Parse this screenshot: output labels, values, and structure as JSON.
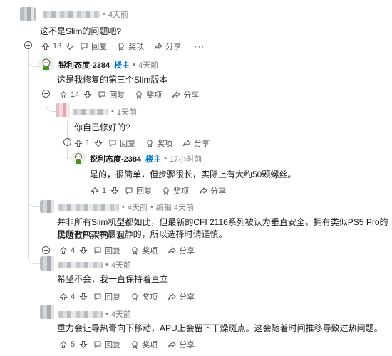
{
  "comments": [
    {
      "time": "4天前",
      "text": "这不是Slim的问题吧?",
      "votes": "13"
    },
    {
      "user": "锐利态度-2384",
      "op_badge": "楼主",
      "time": "4天前",
      "text": "这是我修复的第三个Slim版本",
      "votes": "14"
    },
    {
      "time": "1天前",
      "text": "你自己修好的?",
      "votes": "1"
    },
    {
      "user": "锐利态度-2384",
      "op_badge": "楼主",
      "time": "17小时前",
      "text": "是的，很简单，但步骤很长，实际上有大约50颗螺丝。",
      "votes": "1"
    },
    {
      "time": "4天前",
      "edited": "编辑 4天前",
      "text_line1": "并非所有Slim机型都如此，但最新的CFI 2116系列被认为垂直安全，拥有类似PS5 Pro的优越散热架构，且",
      "text_line2": "是所有PS5中最安静的，所以选择时请谨慎。",
      "votes": "4"
    },
    {
      "time": "4天前",
      "text": "希望不会，我一直保持着直立",
      "votes": "4"
    },
    {
      "time": "4天前",
      "text": "重力会让导热膏向下移动，APU上会留下干燥斑点。这会随着时间推移导致过热问题。",
      "votes": "5"
    }
  ],
  "labels": {
    "reply": "回复",
    "award": "奖项",
    "share": "分享",
    "more": "···",
    "sep": "•"
  },
  "icons": {
    "upvote": "arrow-up-icon",
    "downvote": "arrow-down-icon",
    "reply": "chat-bubble-icon",
    "award": "award-icon",
    "share": "share-icon",
    "collapse": "minus-circle-icon"
  }
}
